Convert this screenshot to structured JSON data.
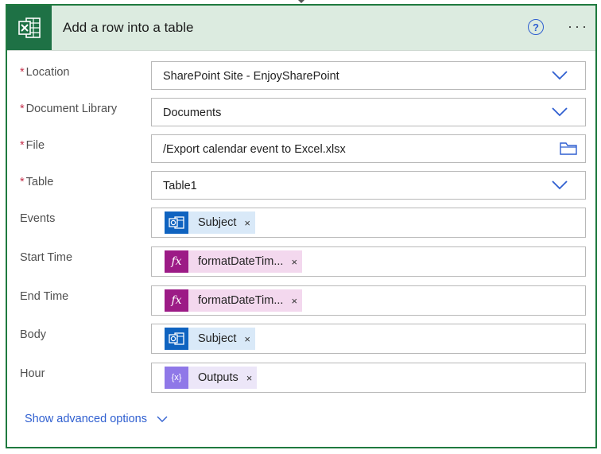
{
  "header": {
    "title": "Add a row into a table",
    "help_glyph": "?",
    "more_glyph": "···"
  },
  "fields": {
    "location": {
      "label": "Location",
      "required_mark": "*",
      "value": "SharePoint Site - EnjoySharePoint"
    },
    "document_library": {
      "label": "Document Library",
      "required_mark": "*",
      "value": "Documents"
    },
    "file": {
      "label": "File",
      "required_mark": "*",
      "value": "/Export calendar event to Excel.xlsx"
    },
    "table": {
      "label": "Table",
      "required_mark": "*",
      "value": "Table1"
    },
    "events": {
      "label": "Events",
      "token": "Subject",
      "token_icon": "outlook-icon"
    },
    "start_time": {
      "label": "Start Time",
      "token": "formatDateTim...",
      "token_icon": "fx-icon",
      "icon_text": "fx"
    },
    "end_time": {
      "label": "End Time",
      "token": "formatDateTim...",
      "token_icon": "fx-icon",
      "icon_text": "fx"
    },
    "body": {
      "label": "Body",
      "token": "Subject",
      "token_icon": "outlook-icon"
    },
    "hour": {
      "label": "Hour",
      "token": "Outputs",
      "token_icon": "variable-icon",
      "icon_text": "{x}"
    }
  },
  "token_close_glyph": "×",
  "advanced": {
    "label": "Show advanced options"
  },
  "colors": {
    "accent": "#2f5fd0",
    "excel_green": "#1e7145",
    "required": "#c4314b"
  }
}
